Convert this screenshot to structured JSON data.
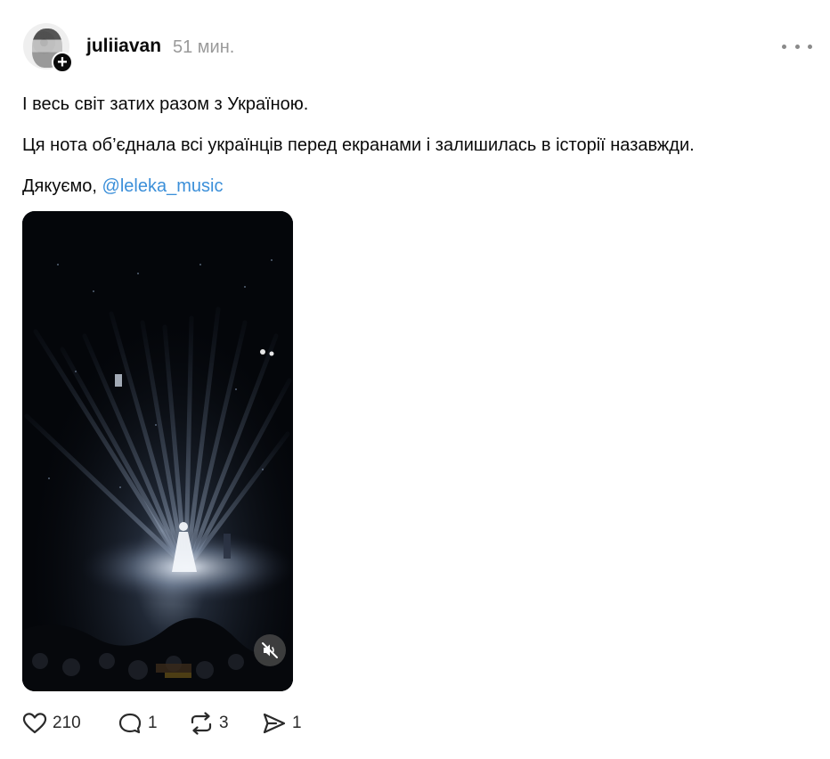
{
  "post": {
    "username": "juliiavan",
    "timestamp": "51 мин.",
    "lines": [
      "І весь світ затих разом з Україною.",
      "Ця нота об’єднала всі українців перед екранами і залишилась в історії назавжди."
    ],
    "thanks_prefix": "Дякуємо, ",
    "mention": "@leleka_music"
  },
  "actions": {
    "likes": "210",
    "replies": "1",
    "reposts": "3",
    "shares": "1"
  },
  "icons": {
    "like": "heart-icon",
    "reply": "speech-bubble-icon",
    "repost": "repost-icon",
    "share": "send-icon",
    "more": "more-dots-icon",
    "mute": "muted-speaker-icon",
    "follow": "plus-icon"
  },
  "colors": {
    "mention": "#3b8fd9",
    "timestamp": "#9a9a9a",
    "video_bg": "#04060a"
  }
}
